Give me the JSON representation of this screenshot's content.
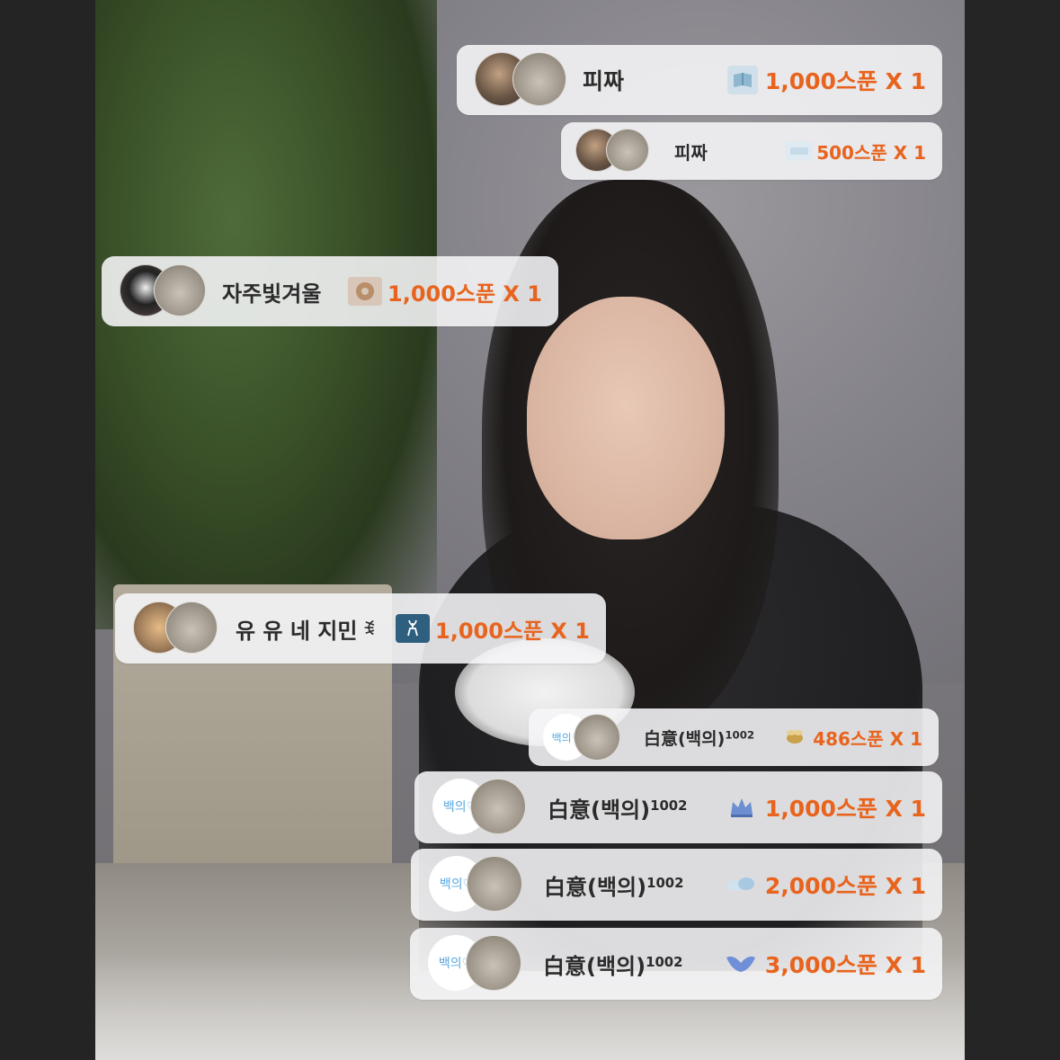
{
  "gifts": [
    {
      "nickname": "피짜",
      "amount": "1,000스푼 X 1",
      "avatar": "photo-cat",
      "gift_icon": "book-icon",
      "gift_color": "#cfe0ea"
    },
    {
      "nickname": "피짜",
      "amount": "500스푼 X 1",
      "avatar": "photo-cat",
      "gift_icon": "snow-icon",
      "gift_color": "#dfeaf2"
    },
    {
      "nickname": "자주빛겨울",
      "amount": "1,000스푼 X 1",
      "avatar": "dog-cat",
      "gift_icon": "donut-icon",
      "gift_color": "#d8c6b8"
    },
    {
      "nickname": "유 유 네 지민",
      "amount": "1,000스푼 X 1",
      "avatar": "kitten-cat",
      "gift_icon": "deer-icon",
      "gift_color": "#2f5f7f",
      "nickname_suffix": "ꉂ"
    },
    {
      "nickname": "白意(백의)",
      "nickname_sup": "1002",
      "amount": "486스푼 X 1",
      "avatar": "text-cat",
      "avatar_text": "백의♡",
      "gift_icon": "bee-icon",
      "gift_color": "#c9a14a"
    },
    {
      "nickname": "白意(백의)",
      "nickname_sup": "1002",
      "amount": "1,000스푼 X 1",
      "avatar": "text-cat",
      "avatar_text": "백의♡",
      "gift_icon": "crown-icon",
      "gift_color": "#6b8fd0"
    },
    {
      "nickname": "白意(백의)",
      "nickname_sup": "1002",
      "amount": "2,000스푼 X 1",
      "avatar": "text-cat",
      "avatar_text": "백의♡",
      "gift_icon": "angel-icon",
      "gift_color": "#a9c8e2"
    },
    {
      "nickname": "白意(백의)",
      "nickname_sup": "1002",
      "amount": "3,000스푼 X 1",
      "avatar": "text-cat",
      "avatar_text": "백의♡",
      "gift_icon": "wing-icon",
      "gift_color": "#6f8fd8"
    }
  ],
  "colors": {
    "amount": "#e8641e",
    "nickname": "#2b2b2b",
    "card_bg": "#f6f6f8"
  }
}
